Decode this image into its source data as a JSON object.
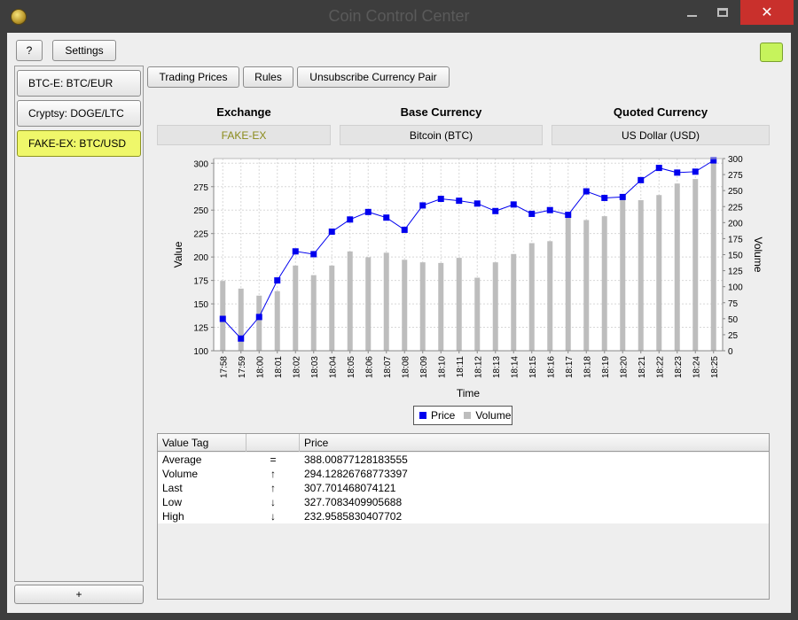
{
  "window": {
    "title": "Coin Control Center",
    "min_icon": "minimize-icon",
    "max_icon": "maximize-icon",
    "close_icon": "close-icon",
    "close_glyph": "✕"
  },
  "toolbar": {
    "help_label": "?",
    "settings_label": "Settings",
    "status_color": "#c6f35c"
  },
  "sidebar": {
    "items": [
      {
        "label": "BTC-E: BTC/EUR",
        "active": false
      },
      {
        "label": "Cryptsy: DOGE/LTC",
        "active": false
      },
      {
        "label": "FAKE-EX: BTC/USD",
        "active": true
      }
    ],
    "add_label": "+"
  },
  "tabs": {
    "trading_prices": "Trading Prices",
    "rules": "Rules",
    "unsubscribe": "Unsubscribe Currency Pair"
  },
  "info": {
    "exchange_label": "Exchange",
    "exchange_value": "FAKE-EX",
    "exchange_color": "#8a8a1a",
    "base_label": "Base Currency",
    "base_value": "Bitcoin (BTC)",
    "quoted_label": "Quoted Currency",
    "quoted_value": "US Dollar (USD)"
  },
  "legend": {
    "price": "Price",
    "volume": "Volume"
  },
  "chart_data": {
    "type": "bar",
    "xlabel": "Time",
    "ylabel": "Value",
    "y2label": "Volume",
    "ylim": [
      100,
      305
    ],
    "y_ticks": [
      100,
      125,
      150,
      175,
      200,
      225,
      250,
      275,
      300
    ],
    "y2lim": [
      0,
      300
    ],
    "y2_ticks": [
      0,
      25,
      50,
      75,
      100,
      125,
      150,
      175,
      200,
      225,
      250,
      275,
      300
    ],
    "categories": [
      "17:58",
      "17:59",
      "18:00",
      "18:01",
      "18:02",
      "18:03",
      "18:04",
      "18:05",
      "18:06",
      "18:07",
      "18:08",
      "18:09",
      "18:10",
      "18:11",
      "18:12",
      "18:13",
      "18:14",
      "18:15",
      "18:16",
      "18:17",
      "18:18",
      "18:19",
      "18:20",
      "18:21",
      "18:22",
      "18:23",
      "18:24",
      "18:25"
    ],
    "series": [
      {
        "name": "Price",
        "type": "line",
        "axis": "left",
        "color": "#0000ee",
        "values": [
          134,
          113,
          136,
          175,
          206,
          203,
          227,
          240,
          248,
          242,
          229,
          255,
          262,
          260,
          257,
          249,
          256,
          246,
          250,
          245,
          270,
          263,
          264,
          282,
          295,
          290,
          291,
          303
        ]
      },
      {
        "name": "Volume",
        "type": "bar",
        "axis": "right",
        "color": "#bdbdbd",
        "values": [
          109,
          97,
          86,
          93,
          133,
          118,
          133,
          155,
          146,
          153,
          142,
          138,
          137,
          145,
          114,
          138,
          151,
          168,
          171,
          211,
          204,
          210,
          239,
          235,
          243,
          261,
          268,
          294
        ]
      }
    ],
    "grid": true,
    "legend": "bottom-center"
  },
  "table": {
    "headers": [
      "Value Tag",
      "",
      "Price"
    ],
    "rows": [
      {
        "tag": "Average",
        "sym": "=",
        "price": "388.00877128183555"
      },
      {
        "tag": "Volume",
        "sym": "↑",
        "price": "294.12826768773397"
      },
      {
        "tag": "Last",
        "sym": "↑",
        "price": "307.701468074121"
      },
      {
        "tag": "Low",
        "sym": "↓",
        "price": "327.7083409905688"
      },
      {
        "tag": "High",
        "sym": "↓",
        "price": "232.9585830407702"
      }
    ]
  }
}
